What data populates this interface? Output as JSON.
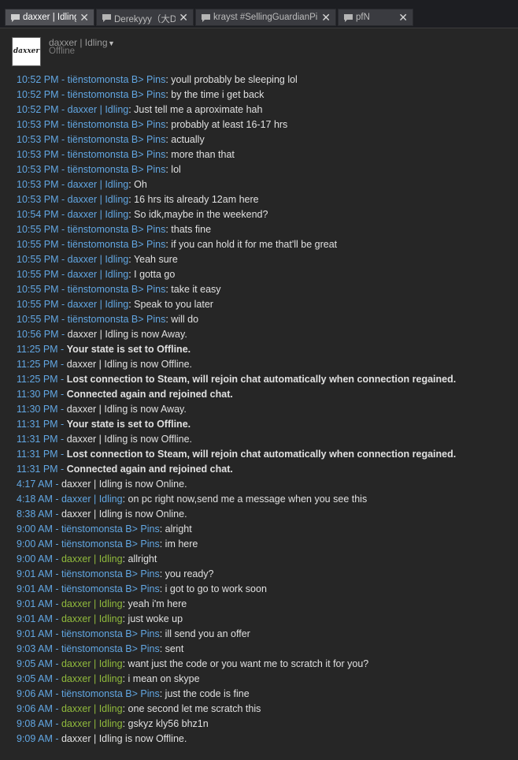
{
  "tabs": [
    {
      "label": "daxxer | Idling",
      "close": "✕",
      "active": true
    },
    {
      "label": "Derekyyy（大D",
      "close": "✕",
      "active": false
    },
    {
      "label": "krayst #SellingGuardianPin",
      "close": "✕",
      "active": false
    },
    {
      "label": "pfN",
      "close": "✕",
      "active": false
    }
  ],
  "header": {
    "avatar_text": "daxxer",
    "username": "daxxer | Idling",
    "status": "Offline"
  },
  "messages": [
    {
      "time": "10:52 PM - ",
      "sender": "tiënstomonsta B> Pins",
      "kind": "friend",
      "text": ": youll probably be sleeping lol"
    },
    {
      "time": "10:52 PM - ",
      "sender": "tiënstomonsta B> Pins",
      "kind": "friend",
      "text": ": by the time i get back"
    },
    {
      "time": "10:52 PM - ",
      "sender": "daxxer | Idling",
      "kind": "me",
      "text": ": Just tell me a aproximate hah"
    },
    {
      "time": "10:53 PM - ",
      "sender": "tiënstomonsta B> Pins",
      "kind": "friend",
      "text": ": probably at least 16-17 hrs"
    },
    {
      "time": "10:53 PM - ",
      "sender": "tiënstomonsta B> Pins",
      "kind": "friend",
      "text": ": actually"
    },
    {
      "time": "10:53 PM - ",
      "sender": "tiënstomonsta B> Pins",
      "kind": "friend",
      "text": ": more than that"
    },
    {
      "time": "10:53 PM - ",
      "sender": "tiënstomonsta B> Pins",
      "kind": "friend",
      "text": ": lol"
    },
    {
      "time": "10:53 PM - ",
      "sender": "daxxer | Idling",
      "kind": "me",
      "text": ": Oh"
    },
    {
      "time": "10:53 PM - ",
      "sender": "daxxer | Idling",
      "kind": "me",
      "text": ": 16 hrs its already 12am here"
    },
    {
      "time": "10:54 PM - ",
      "sender": "daxxer | Idling",
      "kind": "me",
      "text": ": So idk,maybe in the weekend?"
    },
    {
      "time": "10:55 PM - ",
      "sender": "tiënstomonsta B> Pins",
      "kind": "friend",
      "text": ": thats fine"
    },
    {
      "time": "10:55 PM - ",
      "sender": "tiënstomonsta B> Pins",
      "kind": "friend",
      "text": ": if you can hold it for me that'll be great"
    },
    {
      "time": "10:55 PM - ",
      "sender": "daxxer | Idling",
      "kind": "me",
      "text": ": Yeah sure"
    },
    {
      "time": "10:55 PM - ",
      "sender": "daxxer | Idling",
      "kind": "me",
      "text": ": I gotta go"
    },
    {
      "time": "10:55 PM - ",
      "sender": "tiënstomonsta B> Pins",
      "kind": "friend",
      "text": ": take it easy"
    },
    {
      "time": "10:55 PM - ",
      "sender": "daxxer | Idling",
      "kind": "me",
      "text": ": Speak to you later"
    },
    {
      "time": "10:55 PM - ",
      "sender": "tiënstomonsta B> Pins",
      "kind": "friend",
      "text": ": will do"
    },
    {
      "time": "10:56 PM - ",
      "sender": "",
      "kind": "sys",
      "text": "daxxer | Idling is now Away."
    },
    {
      "time": "11:25 PM - ",
      "sender": "",
      "kind": "sysbold",
      "text": "Your state is set to Offline."
    },
    {
      "time": "11:25 PM - ",
      "sender": "",
      "kind": "sys",
      "text": "daxxer | Idling is now Offline."
    },
    {
      "time": "11:25 PM - ",
      "sender": "",
      "kind": "sysbold",
      "text": "Lost connection to Steam, will rejoin chat automatically when connection regained."
    },
    {
      "time": "11:30 PM - ",
      "sender": "",
      "kind": "sysbold",
      "text": "Connected again and rejoined chat."
    },
    {
      "time": "11:30 PM - ",
      "sender": "",
      "kind": "sys",
      "text": "daxxer | Idling is now Away."
    },
    {
      "time": "11:31 PM - ",
      "sender": "",
      "kind": "sysbold",
      "text": "Your state is set to Offline."
    },
    {
      "time": "11:31 PM - ",
      "sender": "",
      "kind": "sys",
      "text": "daxxer | Idling is now Offline."
    },
    {
      "time": "11:31 PM - ",
      "sender": "",
      "kind": "sysbold",
      "text": "Lost connection to Steam, will rejoin chat automatically when connection regained."
    },
    {
      "time": "11:31 PM - ",
      "sender": "",
      "kind": "sysbold",
      "text": "Connected again and rejoined chat."
    },
    {
      "time": "4:17 AM - ",
      "sender": "",
      "kind": "sys",
      "text": "daxxer | Idling is now Online."
    },
    {
      "time": "4:18 AM - ",
      "sender": "daxxer | Idling",
      "kind": "me",
      "text": ": on pc right now,send me a message when you see this"
    },
    {
      "time": "8:38 AM - ",
      "sender": "",
      "kind": "sys",
      "text": "daxxer | Idling is now Online."
    },
    {
      "time": "9:00 AM - ",
      "sender": "tiënstomonsta B> Pins",
      "kind": "friend",
      "text": ": alright"
    },
    {
      "time": "9:00 AM - ",
      "sender": "tiënstomonsta B> Pins",
      "kind": "friend",
      "text": ": im here"
    },
    {
      "time": "9:00 AM - ",
      "sender": "daxxer | Idling",
      "kind": "meonline",
      "text": ": allright"
    },
    {
      "time": "9:01 AM - ",
      "sender": "tiënstomonsta B> Pins",
      "kind": "friend",
      "text": ": you ready?"
    },
    {
      "time": "9:01 AM - ",
      "sender": "tiënstomonsta B> Pins",
      "kind": "friend",
      "text": ": i got to go to work soon"
    },
    {
      "time": "9:01 AM - ",
      "sender": "daxxer | Idling",
      "kind": "meonline",
      "text": ": yeah i'm here"
    },
    {
      "time": "9:01 AM - ",
      "sender": "daxxer | Idling",
      "kind": "meonline",
      "text": ": just woke up"
    },
    {
      "time": "9:01 AM - ",
      "sender": "tiënstomonsta B> Pins",
      "kind": "friend",
      "text": ": ill send you an offer"
    },
    {
      "time": "9:03 AM - ",
      "sender": "tiënstomonsta B> Pins",
      "kind": "friend",
      "text": ": sent"
    },
    {
      "time": "9:05 AM - ",
      "sender": "daxxer | Idling",
      "kind": "meonline",
      "text": ": want just the code or you want me to scratch it for you?"
    },
    {
      "time": "9:05 AM - ",
      "sender": "daxxer | Idling",
      "kind": "meonline",
      "text": ": i mean on skype"
    },
    {
      "time": "9:06 AM - ",
      "sender": "tiënstomonsta B> Pins",
      "kind": "friend",
      "text": ": just the code is fine"
    },
    {
      "time": "9:06 AM - ",
      "sender": "daxxer | Idling",
      "kind": "meonline",
      "text": ": one second let me scratch this"
    },
    {
      "time": "9:08 AM - ",
      "sender": "daxxer | Idling",
      "kind": "meonline",
      "text": ": gskyz kly56 bhz1n"
    },
    {
      "time": "9:09 AM - ",
      "sender": "",
      "kind": "sys",
      "text": "daxxer | Idling is now Offline."
    }
  ],
  "colors": {
    "time": "#62a7e3",
    "friend": "#62a7e3",
    "me_offline": "#62a7e3",
    "me_online": "#90ba3c",
    "text": "#e0e0e0",
    "background": "#262626"
  }
}
